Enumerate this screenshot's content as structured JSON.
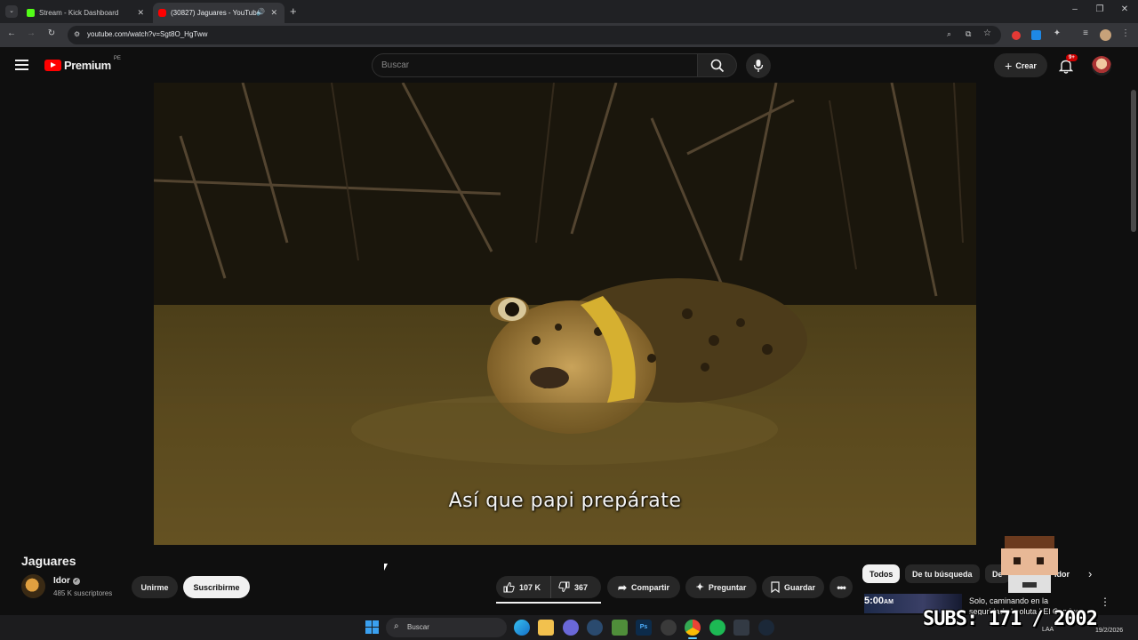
{
  "browser": {
    "tabs": [
      {
        "title": "Stream - Kick Dashboard",
        "favicon_color": "#53fc18"
      },
      {
        "title": "(30827) Jaguares - YouTube",
        "favicon_color": "#ff0000"
      }
    ],
    "new_tab_label": "+",
    "url": "youtube.com/watch?v=Sgt8O_HgTww",
    "window_controls": {
      "minimize": "–",
      "restore": "❐",
      "close": "✕"
    }
  },
  "youtube": {
    "logo_text": "Premium",
    "logo_region": "PE",
    "search_placeholder": "Buscar",
    "create_label": "Crear",
    "notification_count": "9+",
    "accent": "#ff0000"
  },
  "video": {
    "subtitle": "Así que papi prepárate",
    "title": "Jaguares"
  },
  "channel": {
    "name": "Idor",
    "subscribers": "485 K suscriptores",
    "join_label": "Unirme",
    "subscribe_label": "Suscribirme"
  },
  "actions": {
    "likes": "107 K",
    "dislikes": "367",
    "share_label": "Compartir",
    "ask_label": "Preguntar",
    "save_label": "Guardar"
  },
  "chips": [
    "Todos",
    "De tu búsqueda",
    "De",
    "Idor"
  ],
  "recommendation": {
    "duration": "5:00",
    "duration_suffix": "AM",
    "title_line1": "Solo, caminando en la",
    "title_line2": "seguridad absoluta | El Camino"
  },
  "overlay": {
    "subs_text": "SUBS: 171 / 2002"
  },
  "taskbar": {
    "search_placeholder": "Buscar",
    "lang": "LAA",
    "date": "19/2/2026"
  }
}
